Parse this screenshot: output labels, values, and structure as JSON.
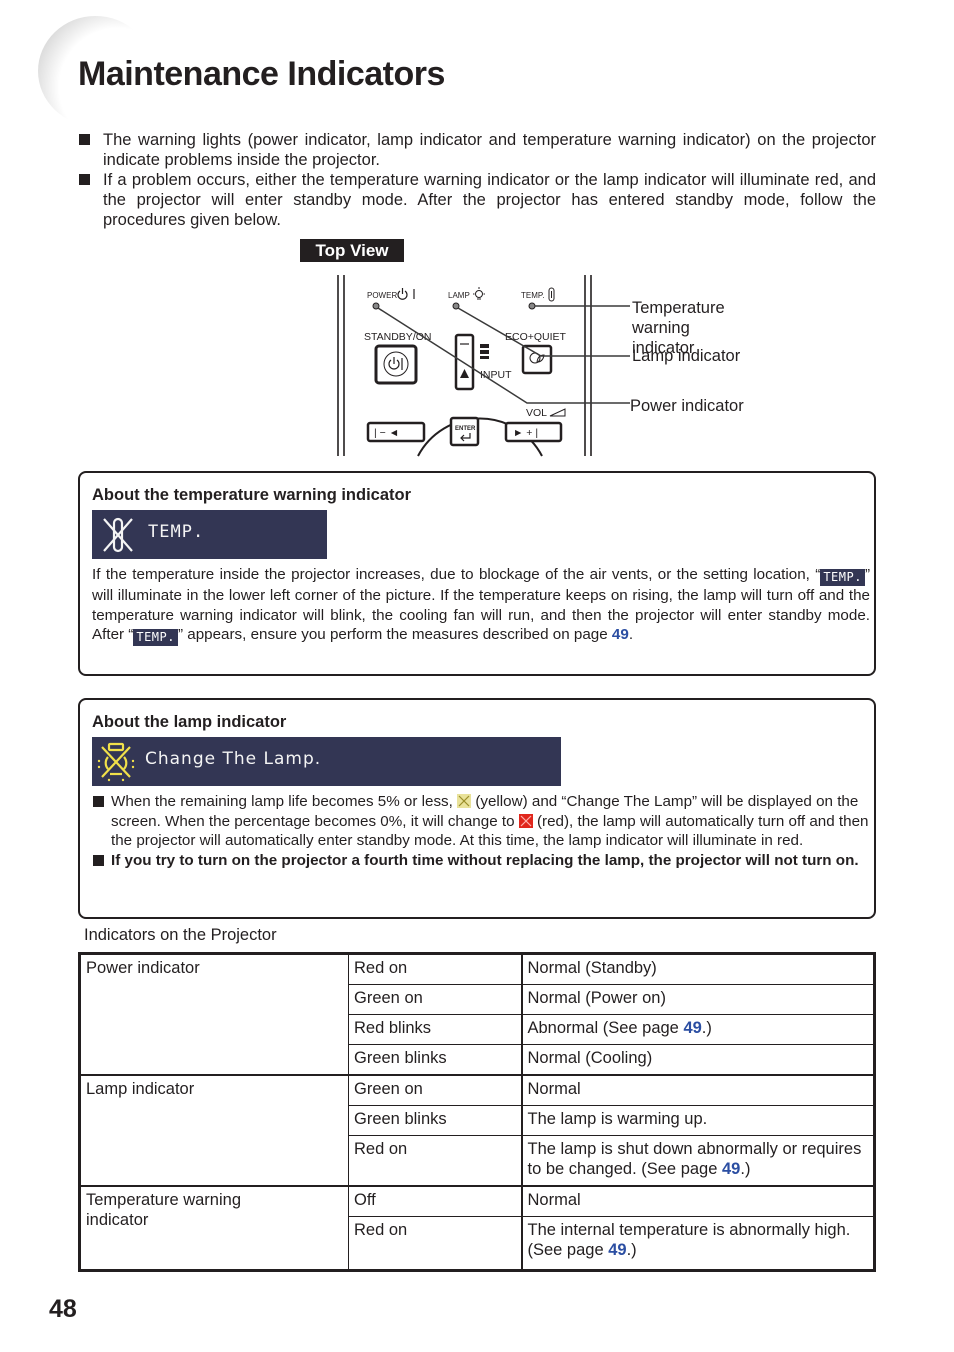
{
  "page": {
    "title": "Maintenance Indicators",
    "page_number": "48"
  },
  "intro": {
    "bullets": [
      "The warning lights (power indicator, lamp indicator and temperature warning indicator) on the projector indicate problems inside the projector.",
      "If a problem occurs, either the temperature warning indicator or the lamp indicator will illuminate red, and the projector will enter standby mode. After the projector has entered standby mode, follow the procedures given below."
    ]
  },
  "diagram": {
    "heading": "Top View",
    "panel_labels": {
      "power": "POWER",
      "lamp": "LAMP",
      "temp": "TEMP.",
      "standby": "STANDBY/ON",
      "eco": "ECO+QUIET",
      "input": "INPUT",
      "vol": "VOL",
      "enter": "ENTER",
      "left_button": "| − ◄",
      "right_button": "► + |"
    },
    "callouts": {
      "temp_line1": "Temperature warning",
      "temp_line2": "indicator",
      "lamp": "Lamp indicator",
      "power": "Power indicator"
    }
  },
  "temp_box": {
    "heading": "About the temperature warning indicator",
    "osd_text": "TEMP.",
    "chip_text": "TEMP.",
    "body": {
      "p1": "If the temperature inside the projector increases, due to blockage of the air vents, or the setting location, “",
      "p2": "” will illuminate in the lower left corner of the picture. If the temperature keeps on rising, the lamp will turn off and the temperature warning indicator will blink, the cooling fan will run, and then the projector will enter standby mode. After “",
      "p3": "” appears, ensure you perform the measures described on page ",
      "page_ref": "49",
      "p4": "."
    }
  },
  "lamp_box": {
    "heading": "About the lamp indicator",
    "osd_text": "Change The Lamp.",
    "bullet1": {
      "a": "When the remaining lamp life becomes 5% or less, ",
      "b": " (yellow) and “Change The Lamp” will be displayed on the screen. When the percentage becomes 0%, it will change to ",
      "c": " (red), the lamp will automatically turn off and then the projector will automatically enter standby mode. At this time, the lamp indicator will illuminate in red."
    },
    "bullet2": "If you try to turn on the projector a fourth time without replacing the lamp, the projector will not turn on.",
    "colors": {
      "yellow": "#f1e04a",
      "red": "#e0261c",
      "osd_bg": "#333654"
    }
  },
  "table": {
    "caption": "Indicators on the Projector",
    "see_page_prefix": "See page ",
    "groups": [
      {
        "indicator": "Power indicator",
        "rows": [
          {
            "state": "Red on",
            "meaning": "Normal (Standby)"
          },
          {
            "state": "Green on",
            "meaning": "Normal (Power on)"
          },
          {
            "state": "Red blinks",
            "meaning_pre": "Abnormal (See page ",
            "page_ref": "49",
            "meaning_post": ".)"
          },
          {
            "state": "Green blinks",
            "meaning": "Normal (Cooling)"
          }
        ]
      },
      {
        "indicator": "Lamp indicator",
        "rows": [
          {
            "state": "Green on",
            "meaning": "Normal"
          },
          {
            "state": "Green blinks",
            "meaning": "The lamp is warming up."
          },
          {
            "state": "Red on",
            "meaning_pre": "The lamp is shut down abnormally or requires to be changed. (See page ",
            "page_ref": "49",
            "meaning_post": ".)"
          }
        ]
      },
      {
        "indicator": "Temperature warning indicator",
        "rows": [
          {
            "state": "Off",
            "meaning": "Normal"
          },
          {
            "state": "Red on",
            "meaning_pre": "The internal temperature is abnormally high. (See page ",
            "page_ref": "49",
            "meaning_post": ".)"
          }
        ]
      }
    ]
  },
  "colors": {
    "text": "#231f20",
    "link": "#2b4ea2",
    "osd_background": "#333654"
  }
}
